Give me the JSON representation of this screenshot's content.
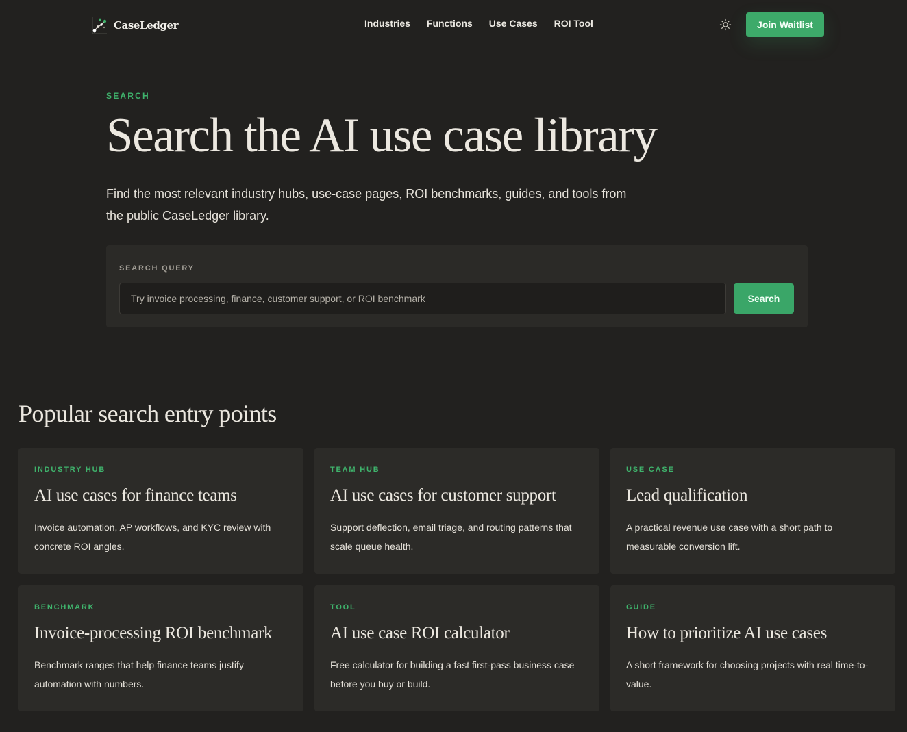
{
  "header": {
    "brand": "CaseLedger",
    "nav": [
      "Industries",
      "Functions",
      "Use Cases",
      "ROI Tool"
    ],
    "theme_icon": "sun-icon",
    "cta": "Join Waitlist"
  },
  "hero": {
    "eyebrow": "SEARCH",
    "title": "Search the AI use case library",
    "description": "Find the most relevant industry hubs, use-case pages, ROI benchmarks, guides, and tools from the public CaseLedger library."
  },
  "search": {
    "label": "SEARCH QUERY",
    "value": "",
    "placeholder": "Try invoice processing, finance, customer support, or ROI benchmark",
    "button": "Search"
  },
  "popular": {
    "title": "Popular search entry points",
    "cards": [
      {
        "type": "INDUSTRY HUB",
        "title": "AI use cases for finance teams",
        "description": "Invoice automation, AP workflows, and KYC review with concrete ROI angles."
      },
      {
        "type": "TEAM HUB",
        "title": "AI use cases for customer support",
        "description": "Support deflection, email triage, and routing patterns that scale queue health."
      },
      {
        "type": "USE CASE",
        "title": "Lead qualification",
        "description": "A practical revenue use case with a short path to measurable conversion lift."
      },
      {
        "type": "BENCHMARK",
        "title": "Invoice-processing ROI benchmark",
        "description": "Benchmark ranges that help finance teams justify automation with numbers."
      },
      {
        "type": "TOOL",
        "title": "AI use case ROI calculator",
        "description": "Free calculator for building a fast first-pass business case before you buy or build."
      },
      {
        "type": "GUIDE",
        "title": "How to prioritize AI use cases",
        "description": "A short framework for choosing projects with real time-to-value."
      }
    ]
  },
  "colors": {
    "background": "#22211f",
    "panel": "#2c2b28",
    "accent": "#3fb36c",
    "text": "#ebe7df"
  }
}
